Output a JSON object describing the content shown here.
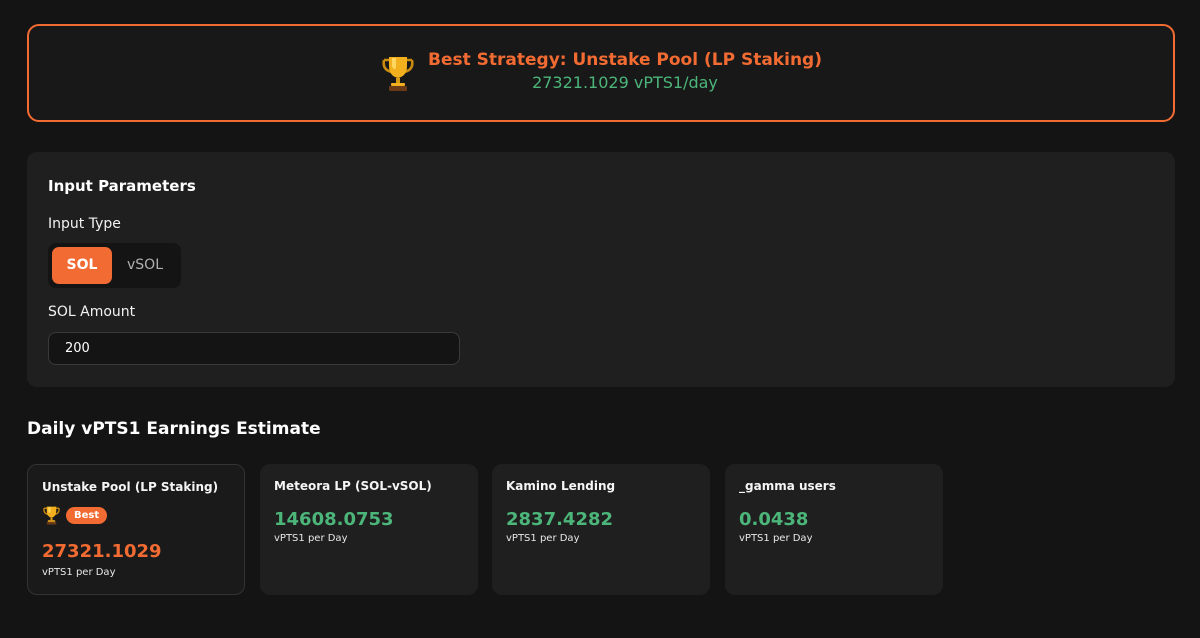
{
  "banner": {
    "title": "Best Strategy: Unstake Pool (LP Staking)",
    "subtitle": "27321.1029 vPTS1/day",
    "icon": "trophy-icon"
  },
  "inputs": {
    "title": "Input Parameters",
    "type_label": "Input Type",
    "type_options": [
      "SOL",
      "vSOL"
    ],
    "type_selected": "SOL",
    "amount_label": "SOL Amount",
    "amount_value": "200"
  },
  "earnings": {
    "title": "Daily vPTS1 Earnings Estimate",
    "cards": [
      {
        "name": "Unstake Pool (LP Staking)",
        "value": "27321.1029",
        "unit": "vPTS1 per Day",
        "best": true,
        "badge": "Best"
      },
      {
        "name": "Meteora LP (SOL-vSOL)",
        "value": "14608.0753",
        "unit": "vPTS1 per Day",
        "best": false
      },
      {
        "name": "Kamino Lending",
        "value": "2837.4282",
        "unit": "vPTS1 per Day",
        "best": false
      },
      {
        "name": "_gamma users",
        "value": "0.0438",
        "unit": "vPTS1 per Day",
        "best": false
      }
    ]
  },
  "colors": {
    "accent": "#f26b32",
    "positive": "#4cb57a",
    "background": "#141414",
    "panel": "#1f1f1f"
  }
}
